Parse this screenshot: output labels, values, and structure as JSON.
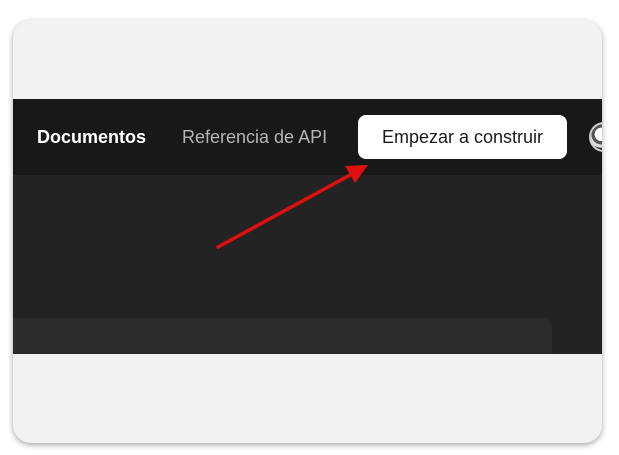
{
  "navbar": {
    "links": [
      {
        "label": "Documentos"
      },
      {
        "label": "Referencia de API"
      }
    ],
    "cta_label": "Empezar a construir"
  },
  "annotation": {
    "arrow_color": "#e01010",
    "arrow_target": "cta-button"
  },
  "colors": {
    "frame_background": "#f2f2f2",
    "navbar_background": "#181818",
    "page_background": "#232323",
    "card_background": "#2c2c2c",
    "cta_background": "#ffffff"
  }
}
